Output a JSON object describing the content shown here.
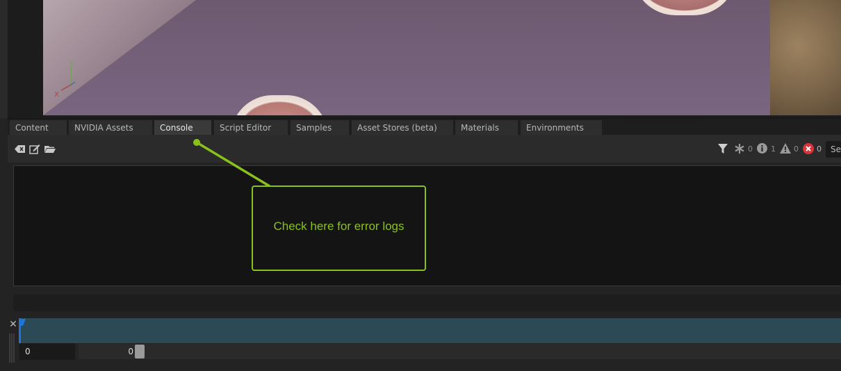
{
  "tabs": [
    {
      "label": "Content",
      "active": false
    },
    {
      "label": "NVIDIA Assets",
      "active": false
    },
    {
      "label": "Console",
      "active": true
    },
    {
      "label": "Script Editor",
      "active": false
    },
    {
      "label": "Samples",
      "active": false
    },
    {
      "label": "Asset Stores (beta)",
      "active": false
    },
    {
      "label": "Materials",
      "active": false
    },
    {
      "label": "Environments",
      "active": false
    }
  ],
  "viewport": {
    "axis": {
      "x": "X",
      "y": "Y"
    }
  },
  "console": {
    "toolbar_icons": [
      "clear-icon",
      "edit-icon",
      "folder-open-icon"
    ],
    "filter_icon": "filter-icon",
    "counters": {
      "all": "0",
      "info": "1",
      "warning": "0",
      "error": "0"
    },
    "search_placeholder": "Se"
  },
  "callout": {
    "text": "Check here for error logs",
    "color": "#8ac21c"
  },
  "timeline": {
    "marker_label": "0",
    "frame_field": "0",
    "slider_value": "0"
  },
  "colors": {
    "accent_green": "#8ac21c",
    "timeline_track": "#2c4a56",
    "playhead": "#1e74d8",
    "error_red": "#d9343a"
  }
}
